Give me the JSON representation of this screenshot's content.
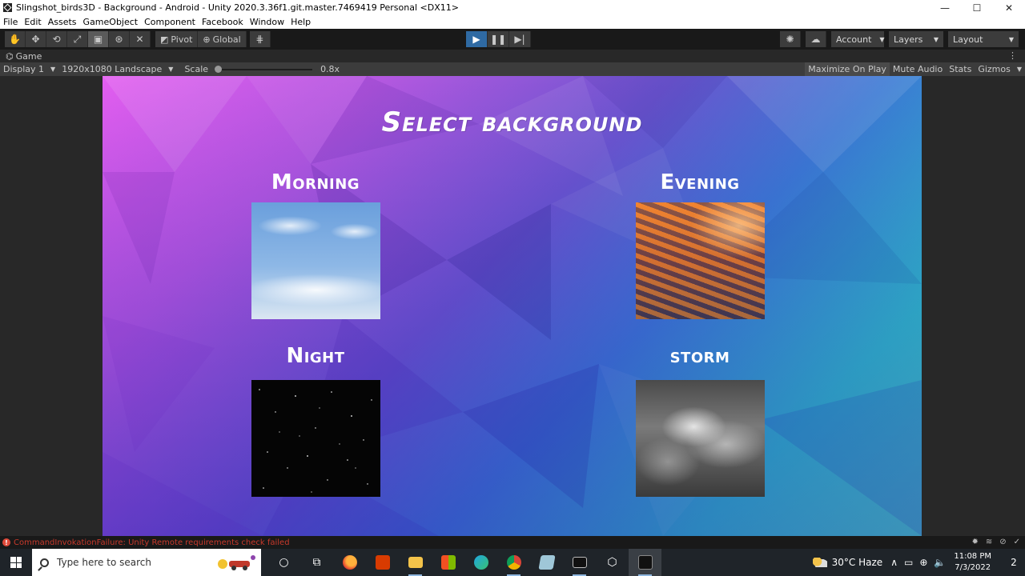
{
  "window": {
    "title": "Slingshot_birds3D - Background - Android - Unity 2020.3.36f1.git.master.7469419 Personal <DX11>",
    "minimize": "—",
    "maximize": "☐",
    "close": "✕"
  },
  "menu": [
    "File",
    "Edit",
    "Assets",
    "GameObject",
    "Component",
    "Facebook",
    "Window",
    "Help"
  ],
  "toolbar": {
    "pivot": "Pivot",
    "global": "Global",
    "account": "Account",
    "layers": "Layers",
    "layout": "Layout"
  },
  "game_tab": {
    "label": "Game"
  },
  "game_bar": {
    "display": "Display 1",
    "resolution": "1920x1080 Landscape",
    "scale_label": "Scale",
    "scale_value": "0.8x",
    "scale_fraction": 0.0,
    "maximize_on_play": "Maximize On Play",
    "mute_audio": "Mute Audio",
    "stats": "Stats",
    "gizmos": "Gizmos"
  },
  "game": {
    "title": "Select background",
    "options": [
      {
        "label": "Morning"
      },
      {
        "label": "Evening"
      },
      {
        "label": "Night"
      },
      {
        "label": "storm"
      }
    ]
  },
  "status": {
    "message": "CommandInvokationFailure: Unity Remote requirements check failed"
  },
  "taskbar": {
    "search_placeholder": "Type here to search",
    "weather": "30°C  Haze",
    "time": "11:08 PM",
    "date": "7/3/2022",
    "notifications": "2"
  }
}
